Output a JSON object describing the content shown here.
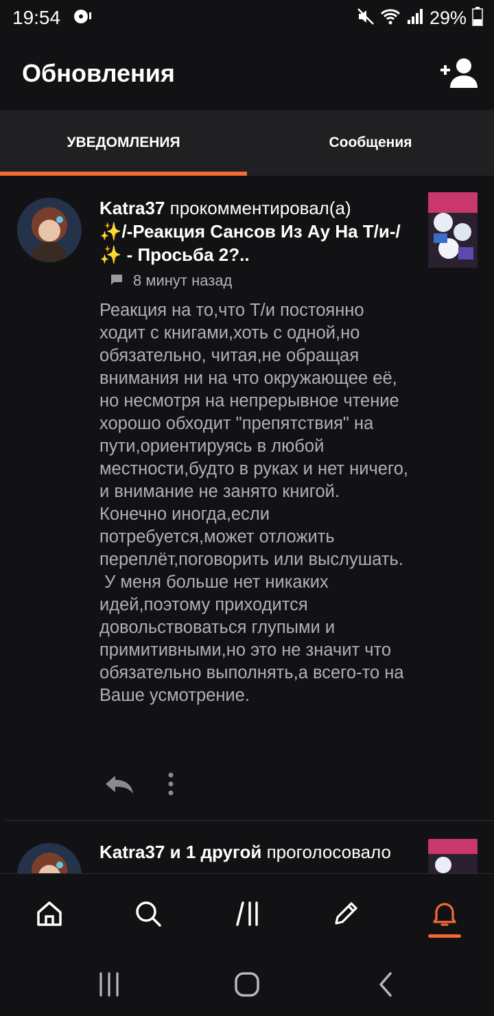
{
  "status_bar": {
    "time": "19:54",
    "battery": "29%"
  },
  "header": {
    "title": "Обновления"
  },
  "tabs": [
    {
      "label": "УВЕДОМЛЕНИЯ",
      "active": true
    },
    {
      "label": "Сообщения",
      "active": false
    }
  ],
  "notifications": [
    {
      "user": "Katra37",
      "action": " прокомментировал(а)",
      "story_title": "✨/-Реакция Сансов Из Ау На Т/и-/✨  - Просьба 2?..",
      "time": "8 минут назад",
      "comment": "Реакция на то,что Т/и постоянно ходит с книгами,хоть с одной,но обязательно, читая,не обращая внимания ни на что окружающее её, но несмотря на непрерывное чтение хорошо обходит \"препятствия\" на пути,ориентируясь в любой местности,будто в руках и нет ничего, и внимание не занято книгой. Конечно иногда,если потребуется,может отложить переплёт,поговорить или выслушать.\n У меня больше нет никаких идей,поэтому приходится довольствоваться глупыми и примитивными,но это не значит что обязательно выполнять,а всего-то на Ваше усмотрение."
    },
    {
      "user": "Katra37 и 1 другой",
      "action": " проголосовало"
    }
  ],
  "colors": {
    "accent": "#f26a34",
    "background": "#121214",
    "tabbar": "#202023"
  }
}
